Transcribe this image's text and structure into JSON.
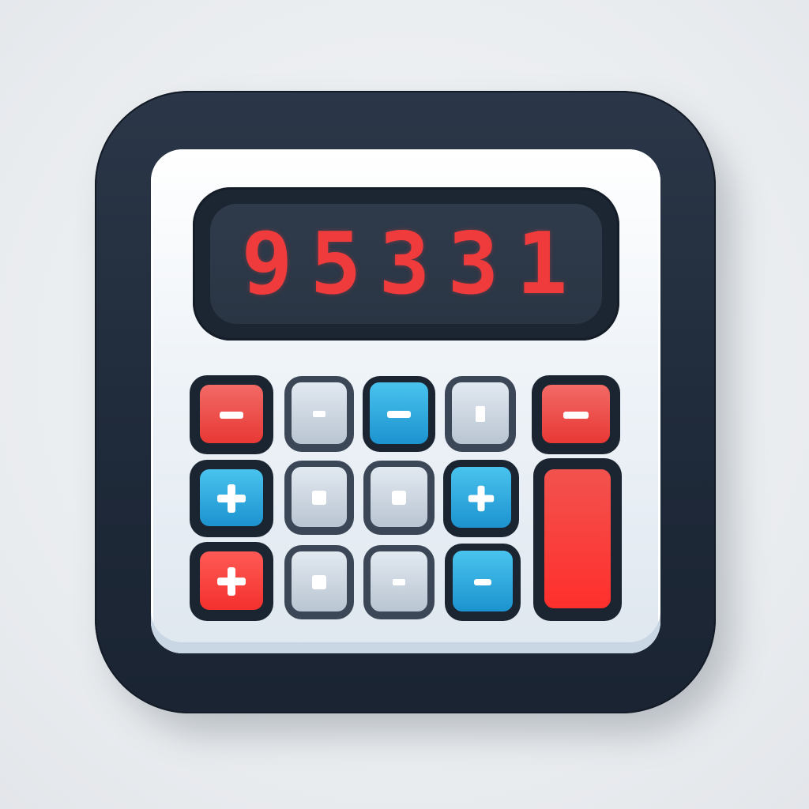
{
  "app": {
    "name": "calculator-app-icon",
    "display": {
      "value": "95331"
    },
    "colors": {
      "frame": "#1f2a3a",
      "display_text": "#ef3b3b",
      "key_red": "#e83835",
      "key_blue": "#1c93cf",
      "key_grey": "#c6d1dc"
    },
    "keys": [
      {
        "row": 1,
        "col": 1,
        "color": "red",
        "icon": "minus-icon"
      },
      {
        "row": 1,
        "col": 2,
        "color": "grey",
        "icon": "dot-icon"
      },
      {
        "row": 1,
        "col": 3,
        "color": "blue",
        "icon": "minus-icon"
      },
      {
        "row": 1,
        "col": 4,
        "color": "grey",
        "icon": "dot-icon"
      },
      {
        "row": 1,
        "col": 5,
        "color": "red",
        "icon": "minus-icon"
      },
      {
        "row": 2,
        "col": 1,
        "color": "blue",
        "icon": "plus-icon"
      },
      {
        "row": 2,
        "col": 2,
        "color": "grey",
        "icon": "dot-icon"
      },
      {
        "row": 2,
        "col": 3,
        "color": "grey",
        "icon": "dot-icon"
      },
      {
        "row": 2,
        "col": 4,
        "color": "blue",
        "icon": "plus-icon"
      },
      {
        "row": 2,
        "col": 5,
        "color": "red",
        "icon": "none",
        "tall": true
      },
      {
        "row": 3,
        "col": 1,
        "color": "red",
        "icon": "plus-icon"
      },
      {
        "row": 3,
        "col": 2,
        "color": "grey",
        "icon": "dot-icon"
      },
      {
        "row": 3,
        "col": 3,
        "color": "grey",
        "icon": "dash-icon"
      },
      {
        "row": 3,
        "col": 4,
        "color": "blue",
        "icon": "minus-icon"
      }
    ]
  }
}
